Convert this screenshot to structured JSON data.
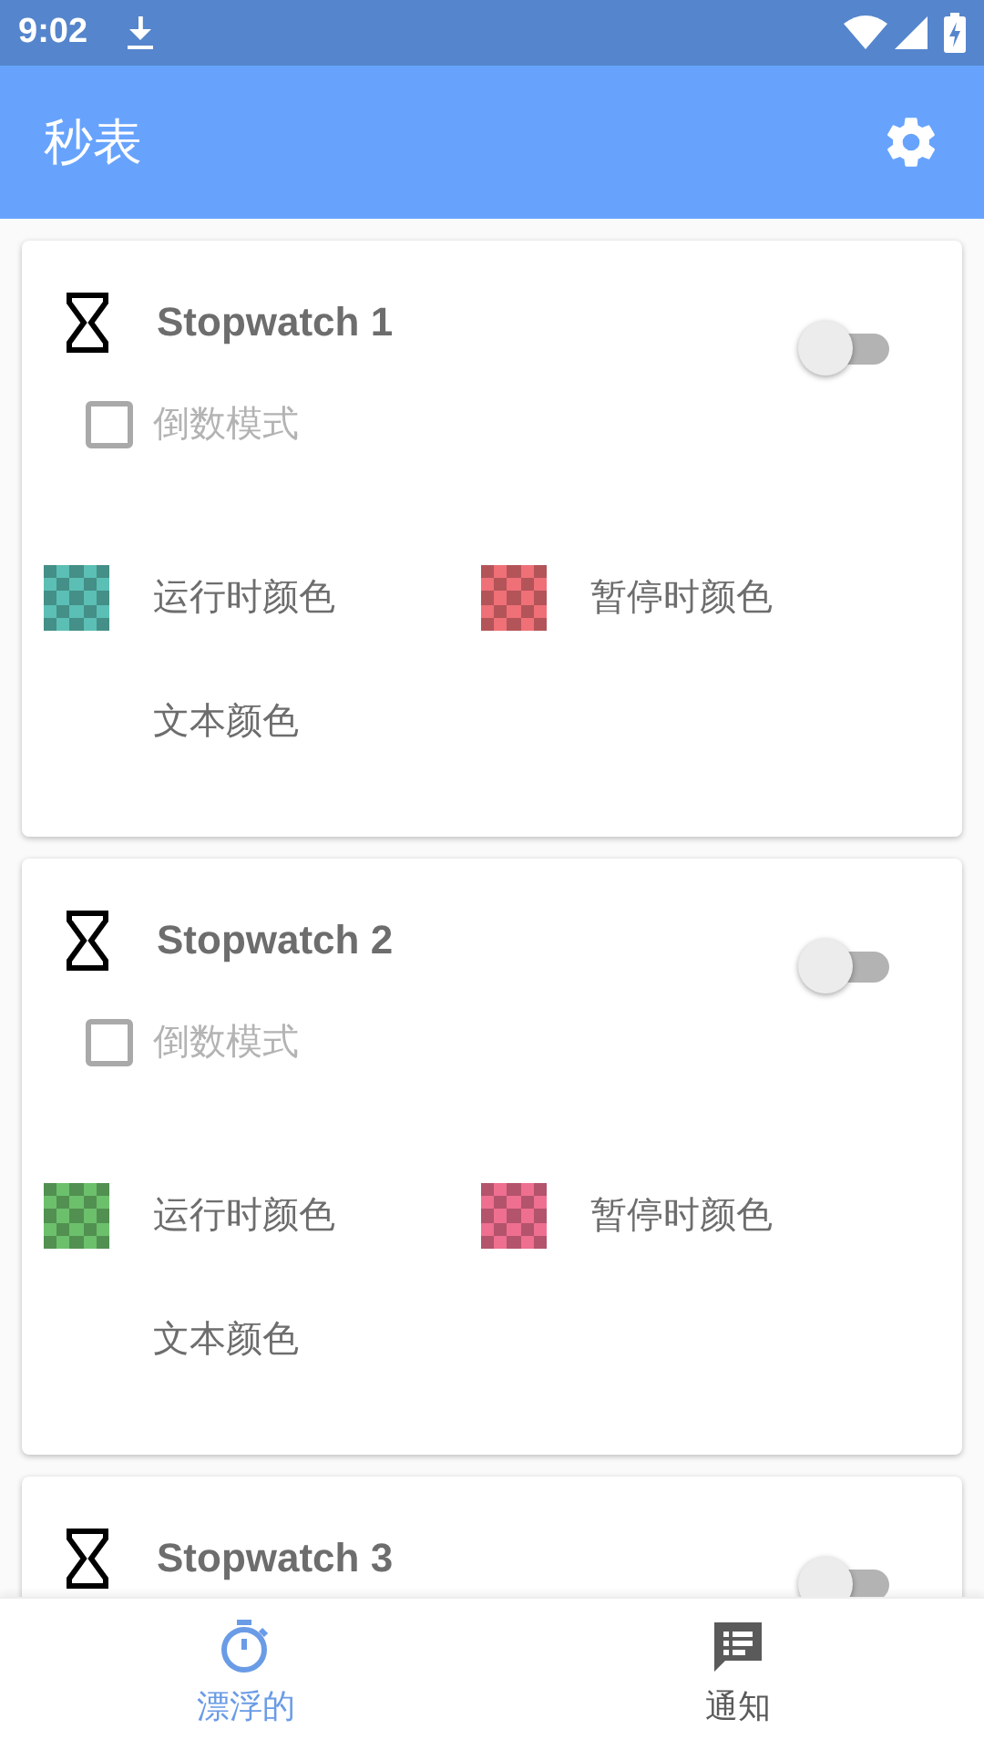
{
  "status_bar": {
    "time": "9:02"
  },
  "app_bar": {
    "title": "秒表"
  },
  "cards": [
    {
      "title": "Stopwatch 1",
      "on": false,
      "countdown": {
        "label": "倒数模式",
        "checked": false
      },
      "colors": [
        {
          "label": "运行时颜色",
          "color": "#5bbfb5"
        },
        {
          "label": "暂停时颜色",
          "color": "#ef7077"
        },
        {
          "label": "文本颜色"
        }
      ]
    },
    {
      "title": "Stopwatch 2",
      "on": false,
      "countdown": {
        "label": "倒数模式",
        "checked": false
      },
      "colors": [
        {
          "label": "运行时颜色",
          "color": "#6cc06c"
        },
        {
          "label": "暂停时颜色",
          "color": "#ef6f90"
        },
        {
          "label": "文本颜色"
        }
      ]
    },
    {
      "title": "Stopwatch 3",
      "on": false
    }
  ],
  "bottom_nav": [
    {
      "label": "漂浮的",
      "selected": true,
      "kind": "timer"
    },
    {
      "label": "通知",
      "selected": false,
      "kind": "notice"
    }
  ]
}
